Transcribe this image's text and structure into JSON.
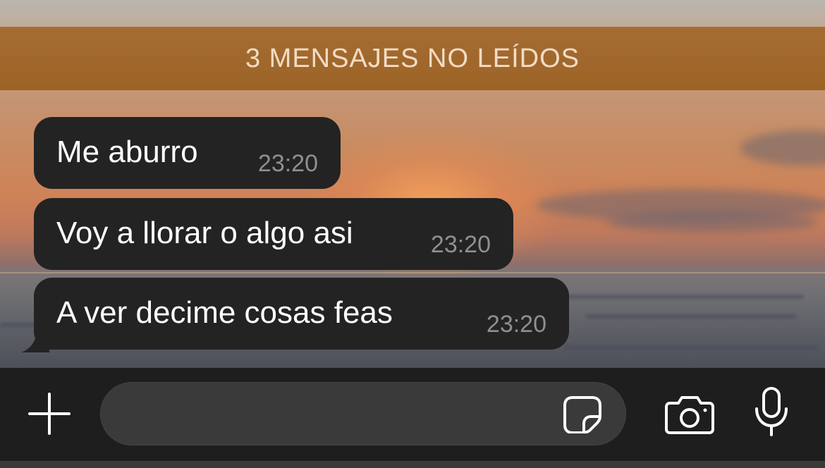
{
  "unread_banner": {
    "label": "3 MENSAJES NO LEÍDOS"
  },
  "messages": [
    {
      "text": "Me aburro",
      "time": "23:20"
    },
    {
      "text": "Voy a llorar o algo asi",
      "time": "23:20"
    },
    {
      "text": "A ver decime cosas feas",
      "time": "23:20"
    }
  ],
  "composer": {
    "placeholder": "",
    "value": "",
    "icons": {
      "attach": "plus-icon",
      "sticker": "sticker-icon",
      "camera": "camera-icon",
      "voice": "microphone-icon"
    }
  },
  "colors": {
    "banner": "#a56d34",
    "bubble": "#232323",
    "input_bar": "#1e1e1e"
  }
}
